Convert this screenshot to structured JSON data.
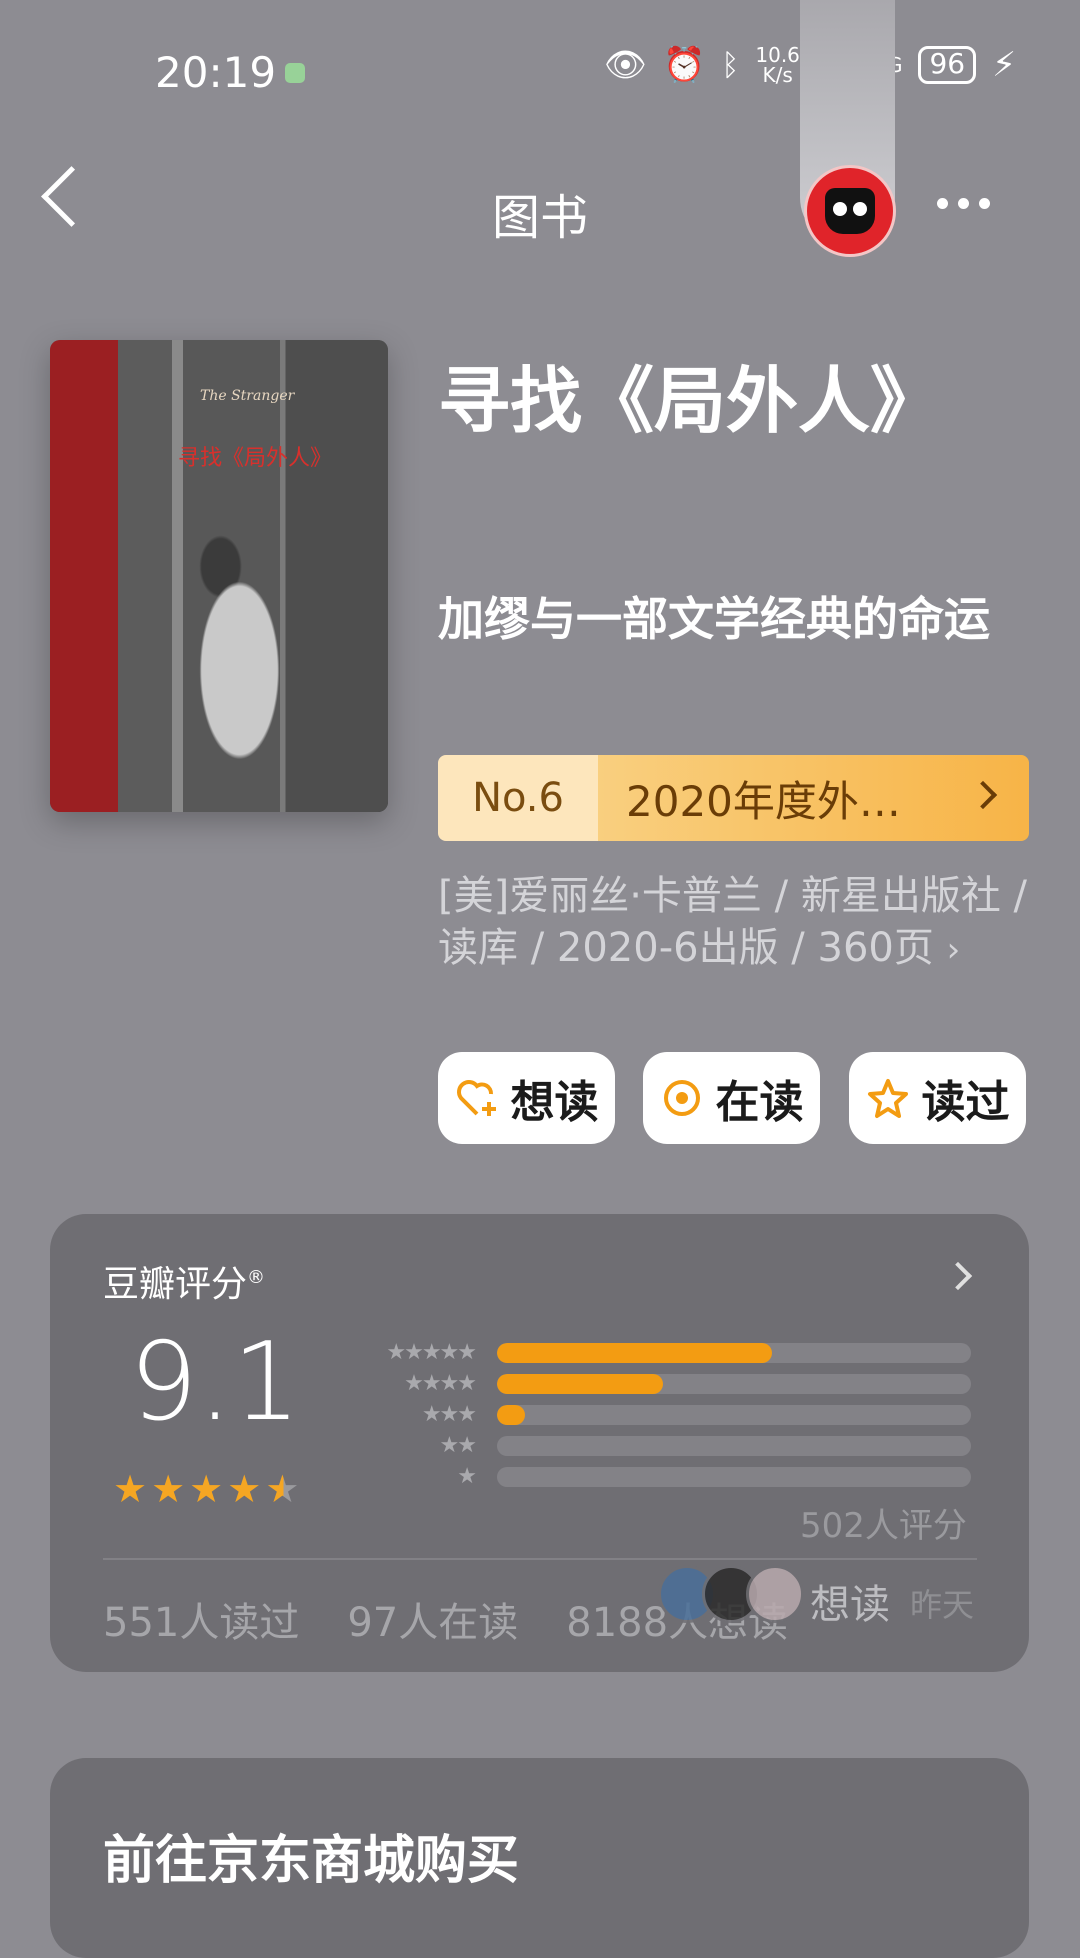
{
  "status_bar": {
    "time": "20:19",
    "net_speed_top": "10.6",
    "net_speed_unit": "K/s",
    "network_type": "5G",
    "battery": "96"
  },
  "nav": {
    "title": "图书"
  },
  "book": {
    "title": "寻找《局外人》",
    "subtitle": "加缪与一部文学经典的命运",
    "rank_no": "No.6",
    "rank_text": "2020年度外…",
    "meta": "[美]爱丽丝·卡普兰 / 新星出版社 / 读库 / 2020-6出版 / 360页",
    "cover_en": "The Stranger",
    "cover_zh": "寻找《局外人》"
  },
  "actions": [
    {
      "label": "想读",
      "icon": "heart-plus-icon"
    },
    {
      "label": "在读",
      "icon": "target-icon"
    },
    {
      "label": "读过",
      "icon": "star-outline-icon"
    }
  ],
  "rating": {
    "title": "豆瓣评分",
    "trademark": "®",
    "score": "9.1",
    "star_value": 4.5,
    "distribution": [
      {
        "stars": 5,
        "fraction": 0.58
      },
      {
        "stars": 4,
        "fraction": 0.35
      },
      {
        "stars": 3,
        "fraction": 0.06
      },
      {
        "stars": 2,
        "fraction": 0.0
      },
      {
        "stars": 1,
        "fraction": 0.0
      }
    ],
    "count_text": "502人评分",
    "read_done": "551人读过",
    "reading": "97人在读",
    "want": "8188人想读",
    "recent_action": "想读",
    "recent_time": "昨天"
  },
  "shop": {
    "title": "前往京东商城购买"
  },
  "colors": {
    "accent": "#f39c12",
    "background": "#8d8c92",
    "card": "#6f6e73"
  }
}
